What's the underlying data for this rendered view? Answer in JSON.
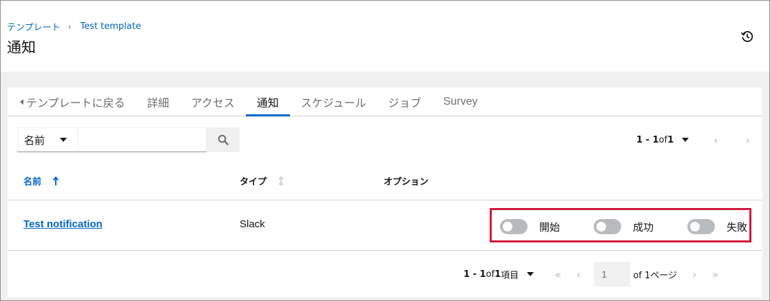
{
  "breadcrumb": {
    "parent": "テンプレート",
    "separator": "›",
    "current": "Test template"
  },
  "page_title": "通知",
  "tabs": {
    "back": "テンプレートに戻る",
    "details": "詳細",
    "access": "アクセス",
    "notifications": "通知",
    "schedules": "スケジュール",
    "jobs": "ジョブ",
    "survey": "Survey"
  },
  "toolbar": {
    "filter_label": "名前",
    "search_placeholder": ""
  },
  "pager_top": {
    "range": "1 - 1",
    "of": "of",
    "total": "1"
  },
  "table": {
    "headers": {
      "name": "名前",
      "type": "タイプ",
      "options": "オプション"
    },
    "rows": [
      {
        "name": "Test notification",
        "type": "Slack",
        "toggles": {
          "start": "開始",
          "success": "成功",
          "failure": "失敗"
        }
      }
    ]
  },
  "pager_bottom": {
    "range": "1 - 1",
    "of": "of",
    "total": "1",
    "items": "項目",
    "page": "1",
    "of_pages": "of 1ページ"
  },
  "colors": {
    "accent": "#0066cc",
    "highlight": "#d3173a",
    "toggle_off": "#b8bbbe"
  }
}
